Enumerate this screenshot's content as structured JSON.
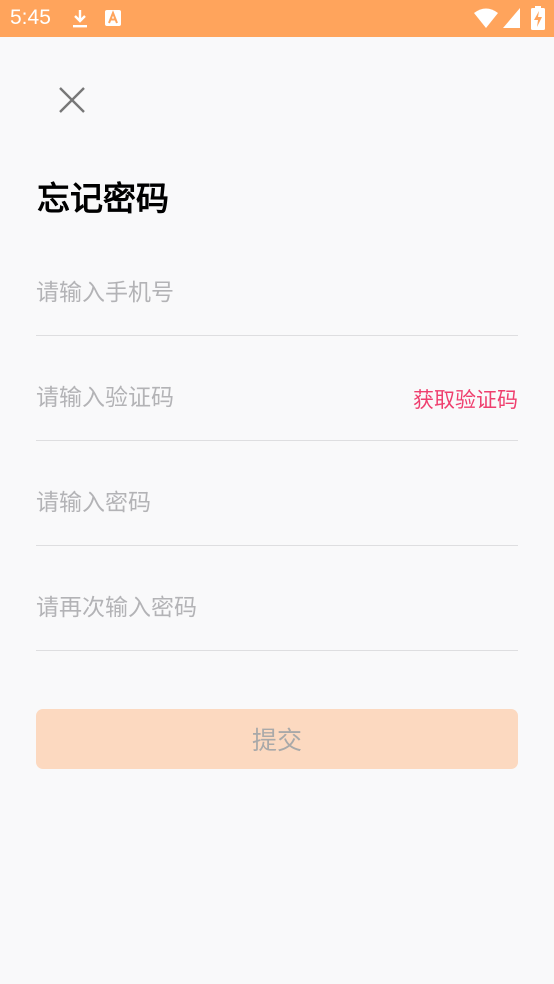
{
  "status_bar": {
    "time": "5:45",
    "icons": [
      "download-icon",
      "a-notification-icon",
      "wifi-icon",
      "signal-icon",
      "battery-charging-icon"
    ],
    "background": "#ffa45c"
  },
  "header": {
    "close_icon": "close-icon",
    "title": "忘记密码"
  },
  "form": {
    "phone_placeholder": "请输入手机号",
    "code_placeholder": "请输入验证码",
    "get_code_label": "获取验证码",
    "password_placeholder": "请输入密码",
    "confirm_placeholder": "请再次输入密码",
    "submit_label": "提交"
  },
  "colors": {
    "accent": "#ffa45c",
    "link": "#ef3f6e",
    "button_bg": "#fcd9c0",
    "button_text": "#a9a9a9"
  }
}
